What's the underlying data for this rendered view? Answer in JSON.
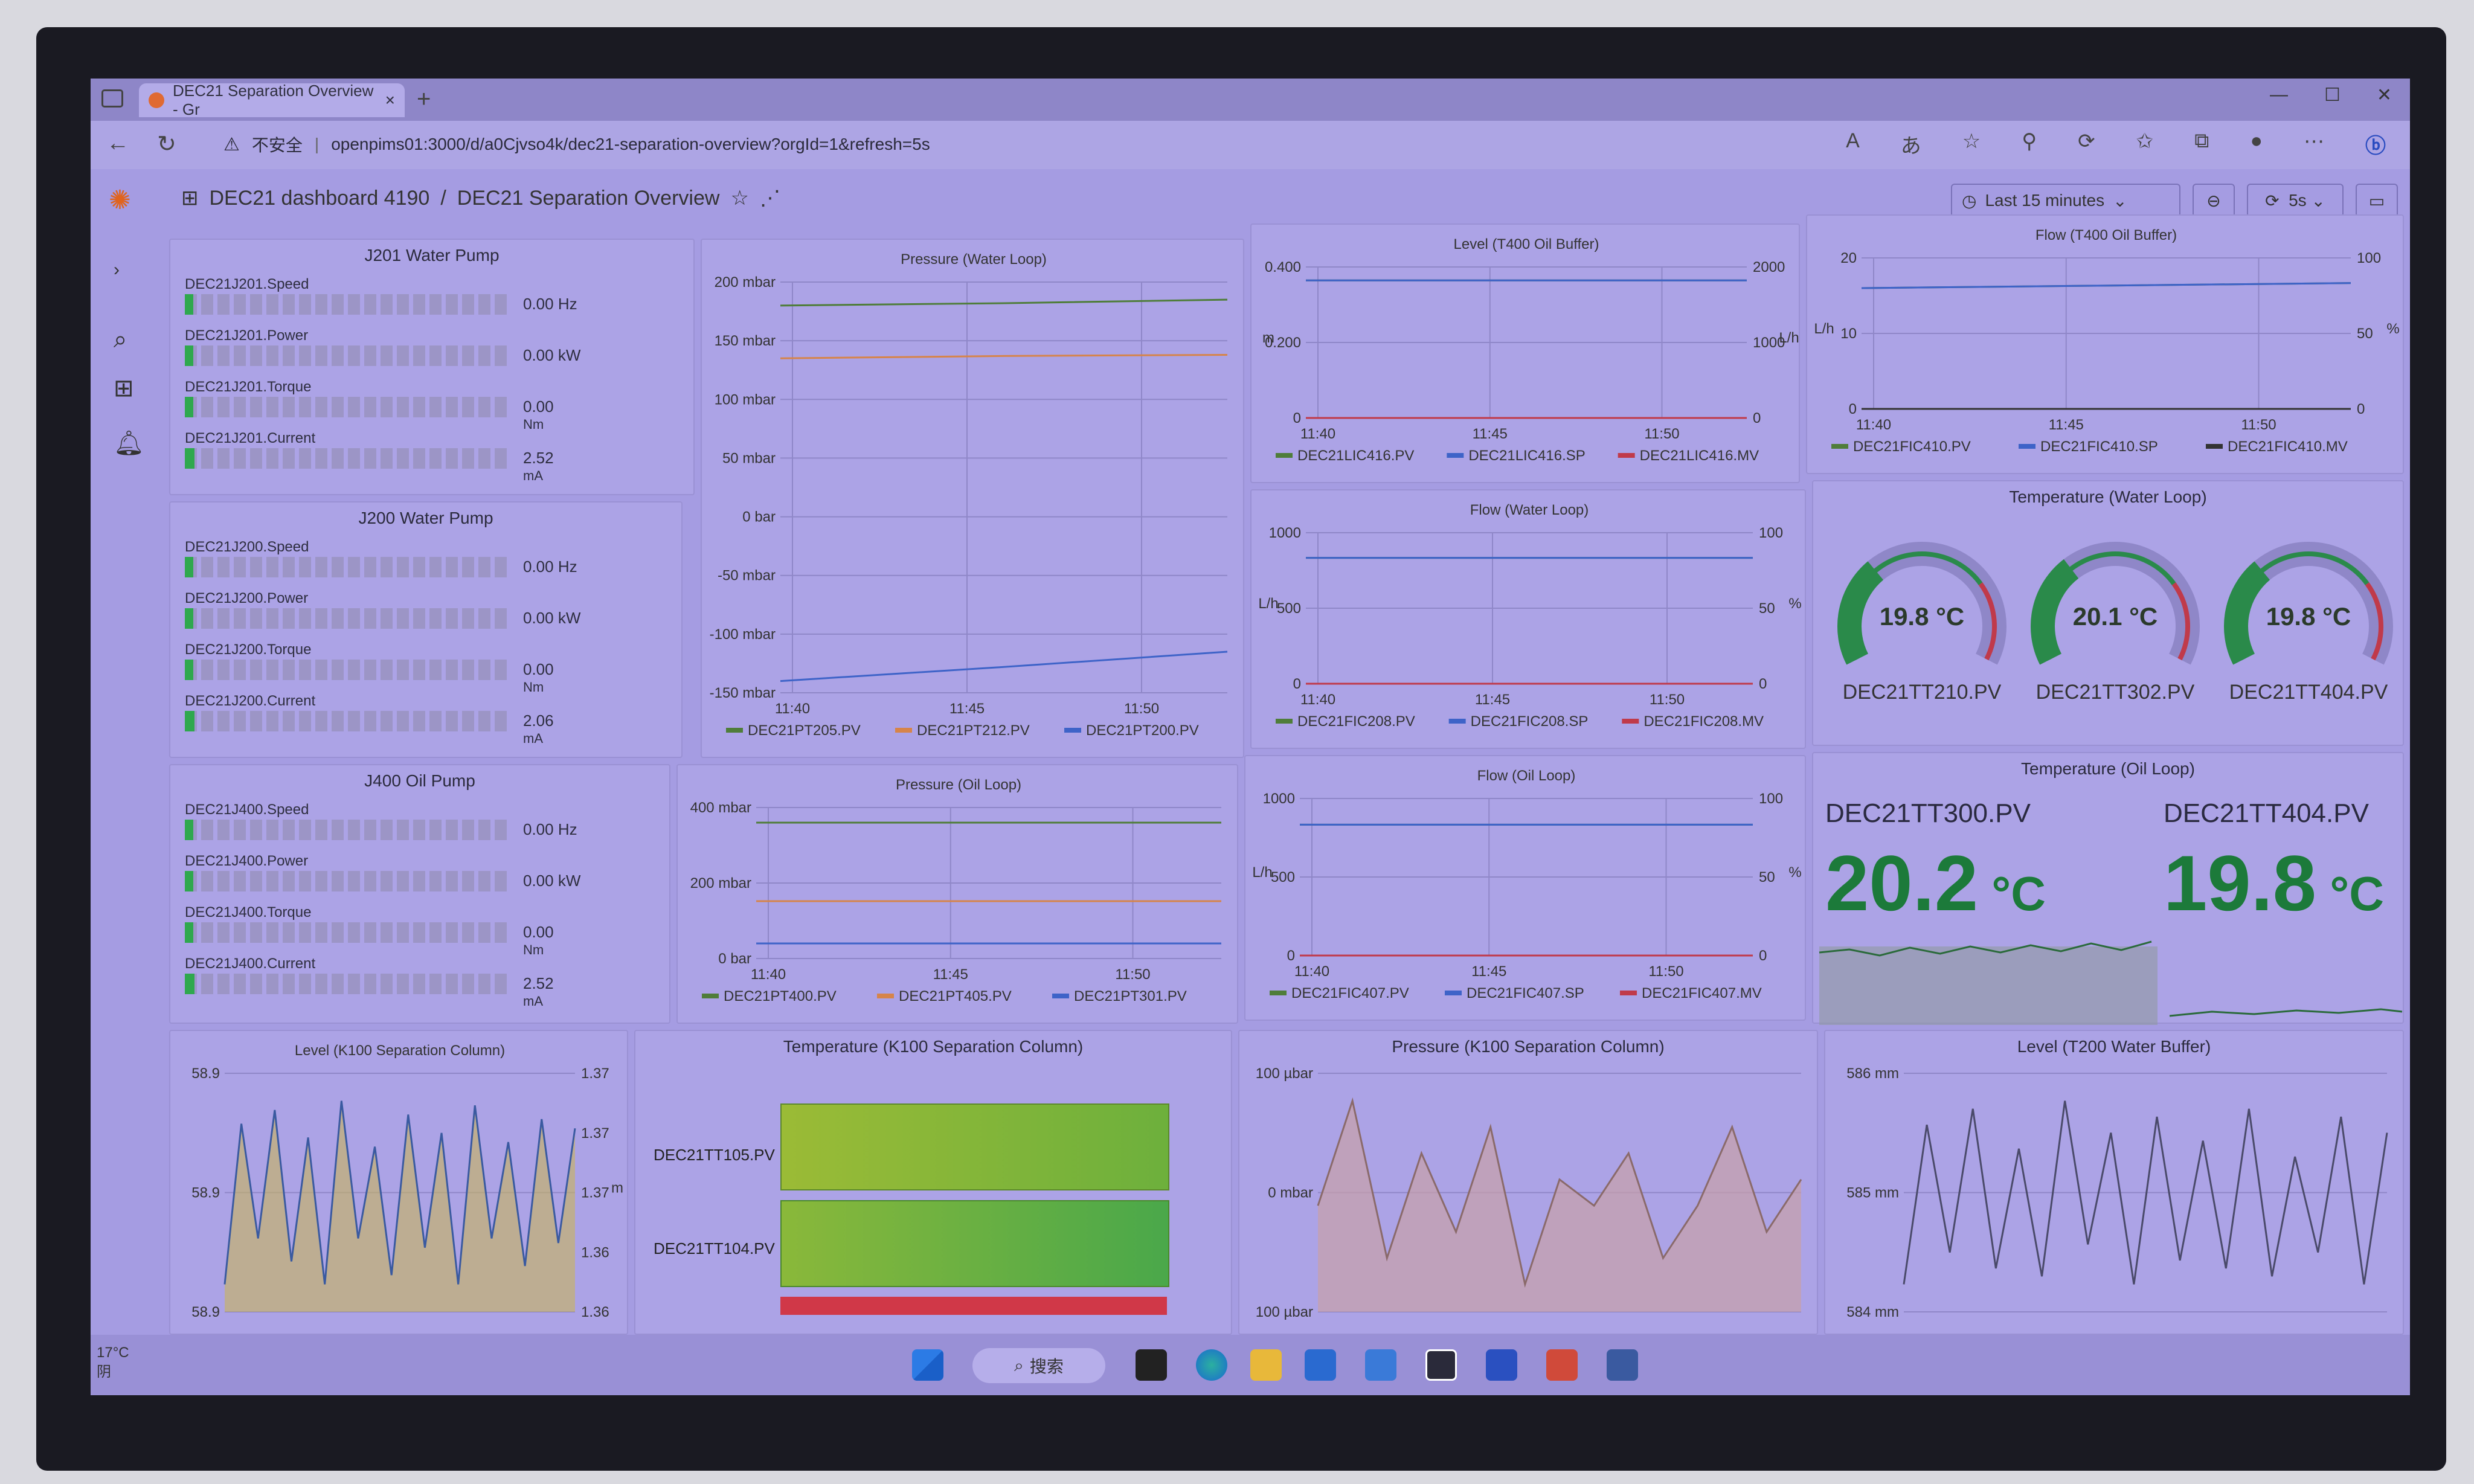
{
  "browser": {
    "tab_title": "DEC21 Separation Overview - Gr",
    "tab_close": "×",
    "new_tab": "+",
    "security_label": "不安全",
    "url": "openpims01:3000/d/a0Cjvso4k/dec21-separation-overview?orgId=1&refresh=5s"
  },
  "header": {
    "folder": "DEC21 dashboard 4190",
    "separator": "/",
    "title": "DEC21 Separation Overview",
    "time_range": "Last 15 minutes",
    "refresh_interval": "5s"
  },
  "panels": {
    "j201": {
      "title": "J201 Water Pump",
      "rows": [
        {
          "label": "DEC21J201.Speed",
          "value": "0.00 Hz",
          "fill": 0.02
        },
        {
          "label": "DEC21J201.Power",
          "value": "0.00 kW",
          "fill": 0.02
        },
        {
          "label": "DEC21J201.Torque",
          "value": "0.00",
          "unit": "Nm",
          "fill": 0.02
        },
        {
          "label": "DEC21J201.Current",
          "value": "2.52",
          "unit": "mA",
          "fill": 0.03
        }
      ]
    },
    "j200": {
      "title": "J200 Water Pump",
      "rows": [
        {
          "label": "DEC21J200.Speed",
          "value": "0.00 Hz",
          "fill": 0.02
        },
        {
          "label": "DEC21J200.Power",
          "value": "0.00 kW",
          "fill": 0.02
        },
        {
          "label": "DEC21J200.Torque",
          "value": "0.00",
          "unit": "Nm",
          "fill": 0.02
        },
        {
          "label": "DEC21J200.Current",
          "value": "2.06",
          "unit": "mA",
          "fill": 0.03
        }
      ]
    },
    "j400": {
      "title": "J400 Oil Pump",
      "rows": [
        {
          "label": "DEC21J400.Speed",
          "value": "0.00 Hz",
          "fill": 0.02
        },
        {
          "label": "DEC21J400.Power",
          "value": "0.00 kW",
          "fill": 0.02
        },
        {
          "label": "DEC21J400.Torque",
          "value": "0.00",
          "unit": "Nm",
          "fill": 0.02
        },
        {
          "label": "DEC21J400.Current",
          "value": "2.52",
          "unit": "mA",
          "fill": 0.03
        }
      ]
    },
    "temp_water": {
      "title": "Temperature (Water Loop)",
      "gauges": [
        {
          "name": "DEC21TT210.PV",
          "value": "19.8 °C",
          "fraction": 0.33
        },
        {
          "name": "DEC21TT302.PV",
          "value": "20.1 °C",
          "fraction": 0.34
        },
        {
          "name": "DEC21TT404.PV",
          "value": "19.8 °C",
          "fraction": 0.33
        }
      ]
    },
    "temp_oil": {
      "title": "Temperature (Oil Loop)",
      "stats": [
        {
          "name": "DEC21TT300.PV",
          "value": "20.2",
          "unit": "°C"
        },
        {
          "name": "DEC21TT404.PV",
          "value": "19.8",
          "unit": "°C"
        }
      ]
    },
    "temp_k100": {
      "title": "Temperature (K100 Separation Column)",
      "labels": [
        "DEC21TT105.PV",
        "DEC21TT104.PV"
      ]
    },
    "pressure_k100": {
      "title": "Pressure (K100 Separation Column)"
    },
    "level_k100": {
      "title": "Level (K100 Separation Column)"
    },
    "level_t200": {
      "title": "Level (T200 Water Buffer)"
    }
  },
  "chart_data": [
    {
      "id": "pressure_water",
      "type": "line",
      "title": "Pressure (Water Loop)",
      "x": [
        "11:40",
        "11:45",
        "11:50"
      ],
      "yticks": [
        "200 mbar",
        "150 mbar",
        "100 mbar",
        "50 mbar",
        "0 bar",
        "-50 mbar",
        "-100 mbar",
        "-150 mbar"
      ],
      "ylim": [
        -150,
        200
      ],
      "series": [
        {
          "name": "DEC21PT205.PV",
          "color": "#4f7d3a",
          "values": [
            180,
            182,
            185
          ]
        },
        {
          "name": "DEC21PT212.PV",
          "color": "#d6844a",
          "values": [
            135,
            137,
            138
          ]
        },
        {
          "name": "DEC21PT200.PV",
          "color": "#3e63c8",
          "values": [
            -140,
            -128,
            -115
          ]
        }
      ]
    },
    {
      "id": "level_t400",
      "type": "line",
      "title": "Level (T400 Oil Buffer)",
      "x": [
        "11:40",
        "11:45",
        "11:50"
      ],
      "ylabel": "m",
      "y2label": "L/h",
      "yticks": [
        "0.400",
        "0.200",
        "0"
      ],
      "y2ticks": [
        "2000",
        "1000",
        "0"
      ],
      "ylim": [
        0,
        0.45
      ],
      "series": [
        {
          "name": "DEC21LIC416.PV",
          "color": "#4f7d3a",
          "values": [
            0.41,
            0.41,
            0.41
          ]
        },
        {
          "name": "DEC21LIC416.SP",
          "color": "#3e63c8",
          "values": [
            0.41,
            0.41,
            0.41
          ]
        },
        {
          "name": "DEC21LIC416.MV",
          "color": "#c03a4a",
          "values": [
            0,
            0,
            0
          ]
        }
      ]
    },
    {
      "id": "flow_t400",
      "type": "line",
      "title": "Flow (T400 Oil Buffer)",
      "x": [
        "11:40",
        "11:45",
        "11:50"
      ],
      "ylabel": "L/h",
      "y2label": "%",
      "yticks": [
        "20",
        "10",
        "0"
      ],
      "y2ticks": [
        "100",
        "50",
        "0"
      ],
      "ylim": [
        0,
        30
      ],
      "series": [
        {
          "name": "DEC21FIC410.PV",
          "color": "#4f7d3a",
          "values": [
            24,
            24.5,
            25
          ]
        },
        {
          "name": "DEC21FIC410.SP",
          "color": "#3e63c8",
          "values": [
            24,
            24.5,
            25
          ]
        },
        {
          "name": "DEC21FIC410.MV",
          "color": "#333333",
          "values": [
            0,
            0,
            0
          ]
        }
      ]
    },
    {
      "id": "flow_water",
      "type": "line",
      "title": "Flow (Water Loop)",
      "x": [
        "11:40",
        "11:45",
        "11:50"
      ],
      "ylabel": "L/h",
      "y2label": "%",
      "yticks": [
        "1000",
        "500",
        "0"
      ],
      "y2ticks": [
        "100",
        "50",
        "0"
      ],
      "ylim": [
        0,
        1200
      ],
      "series": [
        {
          "name": "DEC21FIC208.PV",
          "color": "#4f7d3a",
          "values": [
            1000,
            1000,
            1000
          ]
        },
        {
          "name": "DEC21FIC208.SP",
          "color": "#3e63c8",
          "values": [
            1000,
            1000,
            1000
          ]
        },
        {
          "name": "DEC21FIC208.MV",
          "color": "#c03a4a",
          "values": [
            0,
            0,
            0
          ]
        }
      ]
    },
    {
      "id": "pressure_oil",
      "type": "line",
      "title": "Pressure (Oil Loop)",
      "x": [
        "11:40",
        "11:45",
        "11:50"
      ],
      "yticks": [
        "400 mbar",
        "200 mbar",
        "0 bar"
      ],
      "ylim": [
        -50,
        450
      ],
      "series": [
        {
          "name": "DEC21PT400.PV",
          "color": "#4f7d3a",
          "values": [
            400,
            400,
            400
          ]
        },
        {
          "name": "DEC21PT405.PV",
          "color": "#d6844a",
          "values": [
            140,
            140,
            140
          ]
        },
        {
          "name": "DEC21PT301.PV",
          "color": "#3e63c8",
          "values": [
            0,
            0,
            0
          ]
        }
      ]
    },
    {
      "id": "flow_oil",
      "type": "line",
      "title": "Flow (Oil Loop)",
      "x": [
        "11:40",
        "11:45",
        "11:50"
      ],
      "ylabel": "L/h",
      "y2label": "%",
      "yticks": [
        "1000",
        "500",
        "0"
      ],
      "y2ticks": [
        "100",
        "50",
        "0"
      ],
      "ylim": [
        0,
        1200
      ],
      "series": [
        {
          "name": "DEC21FIC407.PV",
          "color": "#4f7d3a",
          "values": [
            1000,
            1000,
            1000
          ]
        },
        {
          "name": "DEC21FIC407.SP",
          "color": "#3e63c8",
          "values": [
            1000,
            1000,
            1000
          ]
        },
        {
          "name": "DEC21FIC407.MV",
          "color": "#c03a4a",
          "values": [
            0,
            0,
            0
          ]
        }
      ]
    },
    {
      "id": "level_k100",
      "type": "line",
      "title": "Level (K100 Separation Column)",
      "yticks": [
        "58.9",
        "58.9",
        "58.9"
      ],
      "y2ticks": [
        "1.37",
        "1.37",
        "1.37",
        "1.36",
        "1.36"
      ],
      "y2label": "m",
      "series": [
        {
          "values": [
            58.6,
            58.95,
            58.7,
            58.98,
            58.65,
            58.92,
            58.6,
            59.0,
            58.7,
            58.9,
            58.62,
            58.97,
            58.68,
            58.93,
            58.6,
            58.99,
            58.7,
            58.91,
            58.64,
            58.96,
            58.69,
            58.94
          ]
        }
      ]
    },
    {
      "id": "pressure_k100",
      "type": "area",
      "yticks": [
        "100 µbar",
        "0 mbar",
        "100 µbar"
      ],
      "series": [
        {
          "values": [
            100,
            104,
            98,
            102,
            99,
            103,
            97,
            101,
            100,
            102,
            98,
            100,
            103,
            99,
            101
          ]
        }
      ]
    },
    {
      "id": "level_t200",
      "type": "line",
      "yticks": [
        "586 mm",
        "585 mm",
        "584 mm"
      ],
      "series": [
        {
          "values": [
            583.8,
            585.8,
            584.2,
            586.0,
            584.0,
            585.5,
            583.9,
            586.1,
            584.3,
            585.7,
            583.8,
            585.9,
            584.1,
            585.6,
            584.0,
            586.0,
            583.9,
            585.4,
            584.2,
            585.9,
            583.8,
            585.7
          ]
        }
      ]
    }
  ],
  "taskbar": {
    "search_label": "搜索",
    "weather_temp": "17°C",
    "weather_text": "阴"
  }
}
